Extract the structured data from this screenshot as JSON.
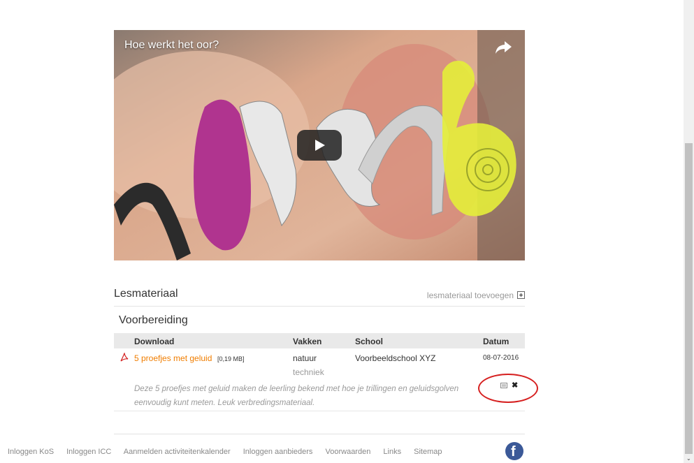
{
  "video": {
    "title": "Hoe werkt het oor?",
    "icons": [
      "share-icon",
      "play-icon"
    ]
  },
  "lesmateriaal": {
    "title": "Lesmateriaal",
    "add_label": "lesmateriaal toevoegen"
  },
  "section": {
    "title": "Voorbereiding"
  },
  "table": {
    "headers": [
      "Download",
      "Vakken",
      "School",
      "Datum"
    ],
    "row": {
      "file_name": "5 proefjes met geluid",
      "file_size": "[0,19 MB]",
      "vakken": [
        "natuur",
        "techniek"
      ],
      "school": "Voorbeeldschool XYZ",
      "datum": "08-07-2016",
      "description": "Deze 5 proefjes met geluid maken de leerling bekend met hoe je trillingen en geluidsgolven eenvoudig kunt meten. Leuk verbredingsmateriaal.",
      "icons": [
        "pdf-icon",
        "edit-icon",
        "delete-icon"
      ],
      "delete_label": "✖"
    }
  },
  "footer": {
    "links": [
      "Inloggen KoS",
      "Inloggen ICC",
      "Aanmelden activiteitenkalender",
      "Inloggen aanbieders",
      "Voorwaarden",
      "Links",
      "Sitemap"
    ],
    "facebook_label": "f"
  },
  "scrollbar": {
    "arrow": "⌄"
  },
  "colors": {
    "link_orange": "#f07d00",
    "highlight_red": "#d62020",
    "facebook_blue": "#3b5998"
  }
}
